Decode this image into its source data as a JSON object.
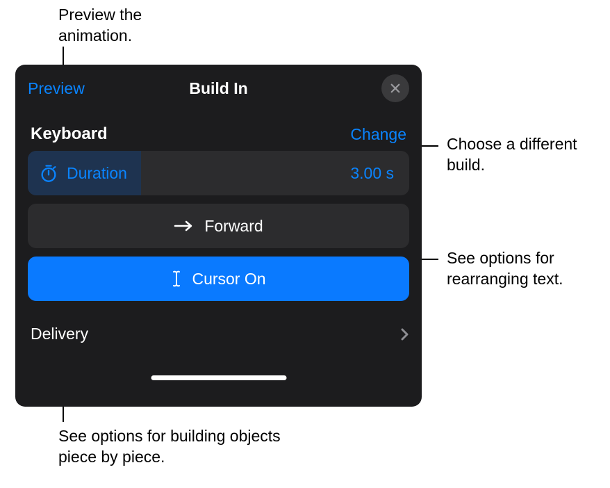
{
  "titlebar": {
    "preview": "Preview",
    "title": "Build In"
  },
  "effect": {
    "name": "Keyboard",
    "change": "Change"
  },
  "duration": {
    "label": "Duration",
    "value": "3.00 s"
  },
  "direction": {
    "label": "Forward"
  },
  "cursor": {
    "label": "Cursor On"
  },
  "delivery": {
    "label": "Delivery"
  },
  "callouts": {
    "preview": "Preview the animation.",
    "change": "Choose a different build.",
    "forward": "See options for rearranging text.",
    "delivery": "See options for building objects piece by piece."
  }
}
